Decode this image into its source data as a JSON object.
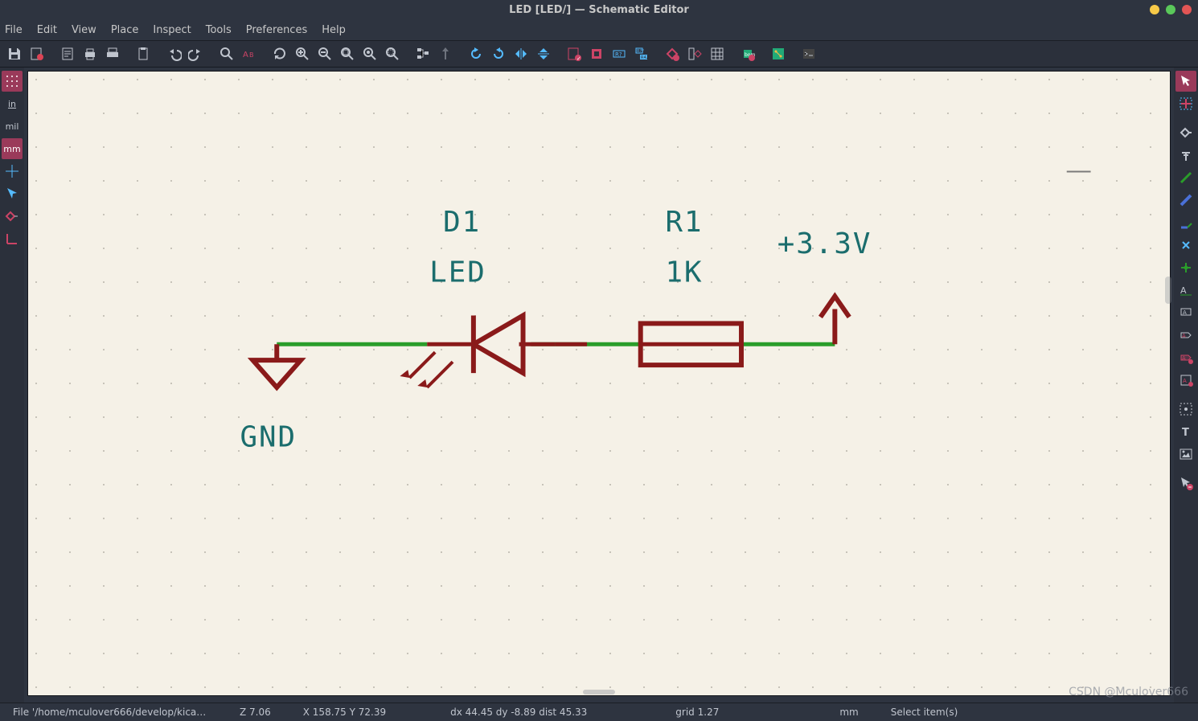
{
  "window": {
    "title": "LED [LED/] — Schematic Editor"
  },
  "menu": {
    "file": "File",
    "edit": "Edit",
    "view": "View",
    "place": "Place",
    "inspect": "Inspect",
    "tools": "Tools",
    "preferences": "Preferences",
    "help": "Help"
  },
  "toolbar_icons": [
    "save",
    "schematic-setup",
    "page-settings",
    "print",
    "plot",
    "paste",
    "undo",
    "redo",
    "find",
    "find-replace",
    "refresh",
    "zoom-in",
    "zoom-out",
    "zoom-fit",
    "zoom-object",
    "zoom-selection",
    "hierarchy",
    "leave-sheet",
    "rotate-ccw",
    "rotate-cw",
    "mirror-h",
    "mirror-v",
    "erc",
    "footprint-assign",
    "annotate",
    "update-fields",
    "sym-editor",
    "sym-browser",
    "sim",
    "bom",
    "pcb-update",
    "pcb-editor",
    "script-console"
  ],
  "left_icons": [
    "grid",
    "in",
    "mil",
    "mm",
    "cursor-full",
    "cursor",
    "hidden-pins",
    "origin"
  ],
  "right_icons": [
    "select",
    "highlight-net",
    "add-symbol",
    "add-power",
    "wire",
    "bus",
    "bus-entry",
    "no-connect",
    "junction",
    "label",
    "net-class",
    "global-label",
    "hier-label",
    "sheet",
    "sheet-pin",
    "sync-sheet",
    "text",
    "textbox",
    "rect",
    "image",
    "delete"
  ],
  "schematic": {
    "d1_ref": "D1",
    "d1_val": "LED",
    "r1_ref": "R1",
    "r1_val": "1K",
    "pwr": "+3.3V",
    "gnd": "GND"
  },
  "status": {
    "file": "File '/home/mculover666/develop/kica…",
    "zoom": "Z 7.06",
    "xy": "X 158.75  Y 72.39",
    "dxy": "dx 44.45  dy -8.89  dist 45.33",
    "grid": "grid 1.27",
    "units": "mm",
    "msg": "Select item(s)"
  },
  "watermark": "CSDN @Mculover666"
}
